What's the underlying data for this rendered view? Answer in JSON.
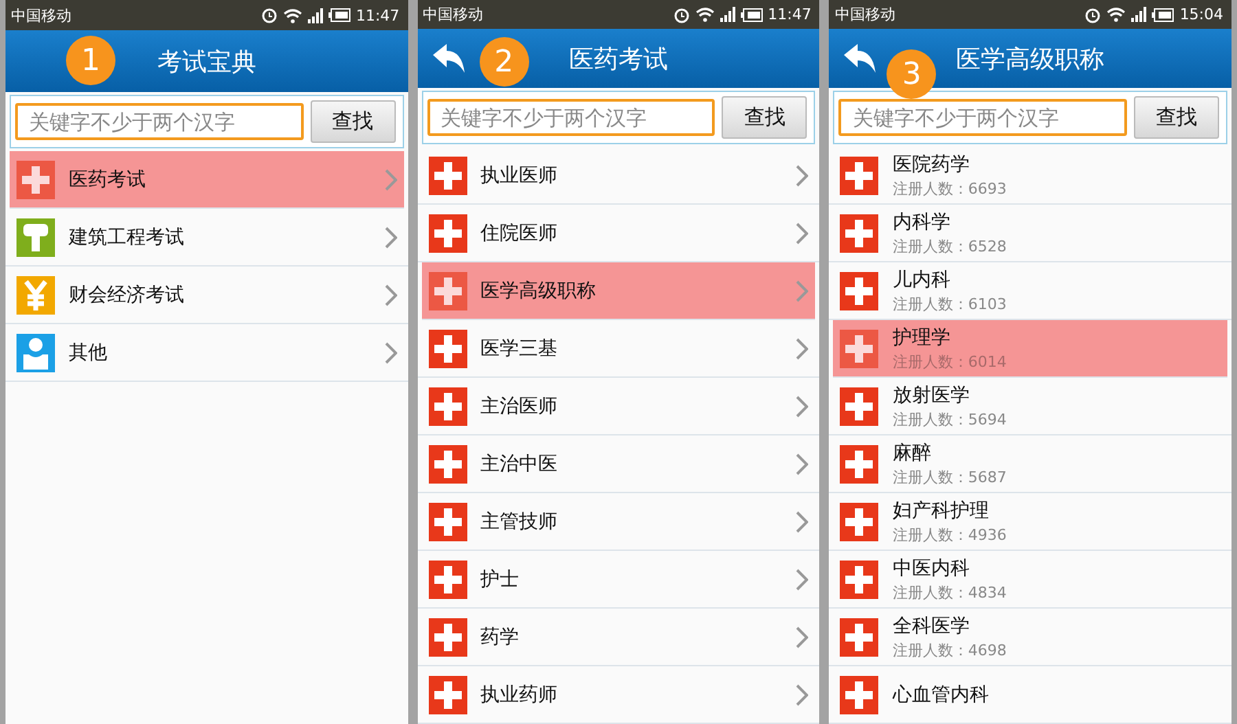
{
  "screens": [
    {
      "step": "1",
      "status": {
        "carrier": "中国移动",
        "time": "11:47"
      },
      "header": {
        "title": "考试宝典",
        "back": false
      },
      "search": {
        "placeholder": "关键字不少于两个汉字",
        "button": "查找"
      },
      "chevrons": true,
      "list": [
        {
          "label": "医药考试",
          "kind": "medical",
          "selected": true
        },
        {
          "label": "建筑工程考试",
          "kind": "building",
          "selected": false
        },
        {
          "label": "财会经济考试",
          "kind": "finance",
          "selected": false
        },
        {
          "label": "其他",
          "kind": "other",
          "selected": false
        }
      ]
    },
    {
      "step": "2",
      "status": {
        "carrier": "中国移动",
        "time": "11:47"
      },
      "header": {
        "title": "医药考试",
        "back": true
      },
      "search": {
        "placeholder": "关键字不少于两个汉字",
        "button": "查找"
      },
      "chevrons": true,
      "list": [
        {
          "label": "执业医师",
          "kind": "medical",
          "selected": false
        },
        {
          "label": "住院医师",
          "kind": "medical",
          "selected": false
        },
        {
          "label": "医学高级职称",
          "kind": "medical",
          "selected": true
        },
        {
          "label": "医学三基",
          "kind": "medical",
          "selected": false
        },
        {
          "label": "主治医师",
          "kind": "medical",
          "selected": false
        },
        {
          "label": "主治中医",
          "kind": "medical",
          "selected": false
        },
        {
          "label": "主管技师",
          "kind": "medical",
          "selected": false
        },
        {
          "label": "护士",
          "kind": "medical",
          "selected": false
        },
        {
          "label": "药学",
          "kind": "medical",
          "selected": false
        },
        {
          "label": "执业药师",
          "kind": "medical",
          "selected": false
        }
      ]
    },
    {
      "step": "3",
      "status": {
        "carrier": "中国移动",
        "time": "15:04"
      },
      "header": {
        "title": "医学高级职称",
        "back": true
      },
      "search": {
        "placeholder": "关键字不少于两个汉字",
        "button": "查找"
      },
      "chevrons": false,
      "list": [
        {
          "label": "医院药学",
          "count": "注册人数：6693",
          "kind": "medical",
          "selected": false
        },
        {
          "label": "内科学",
          "count": "注册人数：6528",
          "kind": "medical",
          "selected": false
        },
        {
          "label": "儿内科",
          "count": "注册人数：6103",
          "kind": "medical",
          "selected": false
        },
        {
          "label": "护理学",
          "count": "注册人数：6014",
          "kind": "medical",
          "selected": true
        },
        {
          "label": "放射医学",
          "count": "注册人数：5694",
          "kind": "medical",
          "selected": false
        },
        {
          "label": "麻醉",
          "count": "注册人数：5687",
          "kind": "medical",
          "selected": false
        },
        {
          "label": "妇产科护理",
          "count": "注册人数：4936",
          "kind": "medical",
          "selected": false
        },
        {
          "label": "中医内科",
          "count": "注册人数：4834",
          "kind": "medical",
          "selected": false
        },
        {
          "label": "全科医学",
          "count": "注册人数：4698",
          "kind": "medical",
          "selected": false
        },
        {
          "label": "心血管内科",
          "kind": "medical",
          "selected": false
        }
      ]
    }
  ]
}
